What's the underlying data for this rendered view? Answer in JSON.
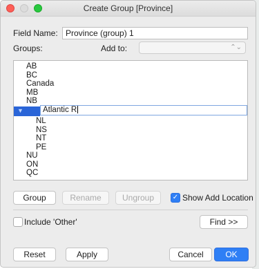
{
  "window": {
    "title": "Create Group [Province]"
  },
  "field_name": {
    "label": "Field Name:",
    "value": "Province (group) 1"
  },
  "groups": {
    "label": "Groups:",
    "add_to_label": "Add to:",
    "add_to_value": ""
  },
  "tree": {
    "items": [
      {
        "label": "AB"
      },
      {
        "label": "BC"
      },
      {
        "label": "Canada"
      },
      {
        "label": "MB"
      },
      {
        "label": "NB"
      },
      {
        "label": "Atlantic R",
        "editing": true
      },
      {
        "label": "NL"
      },
      {
        "label": "NS"
      },
      {
        "label": "NT"
      },
      {
        "label": "PE"
      },
      {
        "label": "NU"
      },
      {
        "label": "ON"
      },
      {
        "label": "QC"
      }
    ]
  },
  "actions": {
    "group": "Group",
    "rename": "Rename",
    "ungroup": "Ungroup",
    "show_add_location": "Show Add Location",
    "show_add_location_checked": true
  },
  "options": {
    "include_other": "Include 'Other'",
    "include_other_checked": false,
    "find": "Find >>"
  },
  "footer": {
    "reset": "Reset",
    "apply": "Apply",
    "cancel": "Cancel",
    "ok": "OK"
  },
  "colors": {
    "accent": "#2f7ff5",
    "selection": "#2a65d8",
    "close": "#fd5f57",
    "maximize": "#29c840"
  }
}
